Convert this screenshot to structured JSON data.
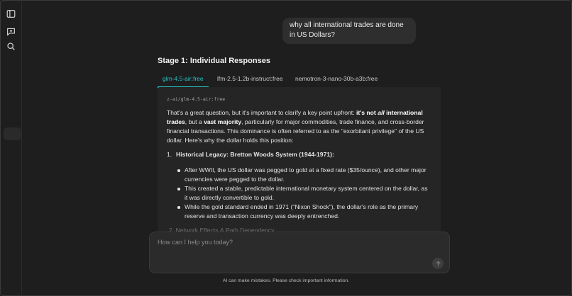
{
  "sidebar": {
    "toggle_icon": "sidebar-panel-icon",
    "new_chat_icon": "new-chat-icon",
    "search_icon": "search-icon"
  },
  "user_message": "why all international trades are done in US Dollars?",
  "stage_title": "Stage 1: Individual Responses",
  "tabs": [
    {
      "label": "glm-4.5-air:free",
      "active": true
    },
    {
      "label": "lfm-2.5-1.2b-instruct:free",
      "active": false
    },
    {
      "label": "nemotron-3-nano-30b-a3b:free",
      "active": false
    }
  ],
  "response": {
    "model_id": "z-ai/glm-4.5-air:free",
    "intro": {
      "t1": "That's a great question, but it's important to clarify a key point upfront: ",
      "b1": "it's not ",
      "b1_italic": "all",
      "b2": " international trades",
      "t2": ", but a ",
      "b3": "vast majority",
      "t3": ", particularly for major commodities, trade finance, and cross-border financial transactions. This dominance is often referred to as the \"exorbitant privilege\" of the US dollar. Here's why the dollar holds this position:"
    },
    "item1_number": "1.",
    "item1_title": "Historical Legacy: Bretton Woods System (1944-1971):",
    "bullets": [
      "After WWII, the US dollar was pegged to gold at a fixed rate ($35/ounce), and other major currencies were pegged to the dollar.",
      "This created a stable, predictable international monetary system centered on the dollar, as it was directly convertible to gold.",
      "While the gold standard ended in 1971 (\"Nixon Shock\"), the dollar's role as the primary reserve and transaction currency was deeply entrenched."
    ],
    "next_item_partial": "2. Network Effects & Path Dependency"
  },
  "composer": {
    "placeholder": "How can I help you today?",
    "value": "",
    "send_icon": "send-arrow-icon"
  },
  "disclaimer": "AI can make mistakes. Please check important information.",
  "colors": {
    "background": "#1e1e1e",
    "accent": "#26c2c6",
    "panel": "#252525"
  }
}
